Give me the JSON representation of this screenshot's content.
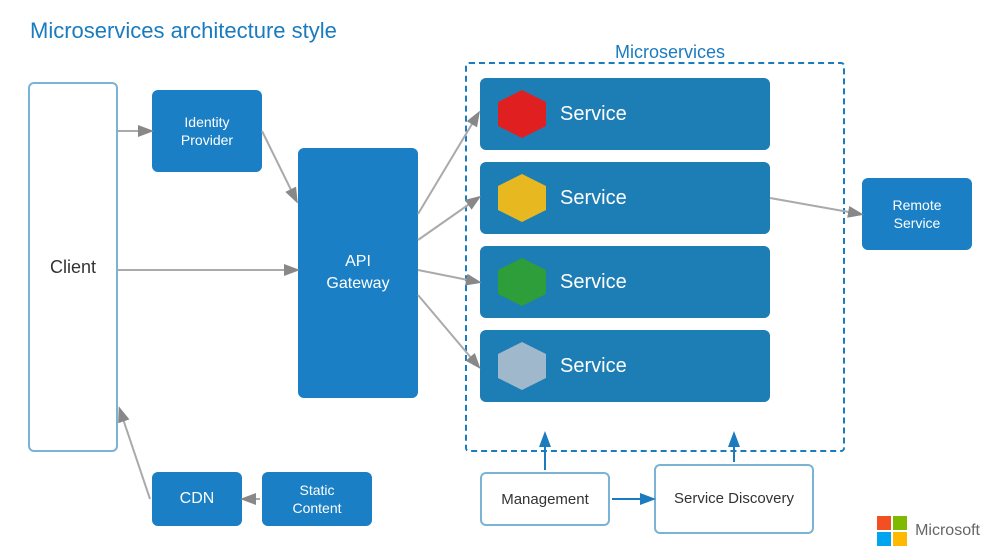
{
  "title": "Microservices architecture style",
  "microservices_label": "Microservices",
  "client_label": "Client",
  "identity_provider_label": "Identity\nProvider",
  "api_gateway_label": "API\nGateway",
  "services": [
    {
      "label": "Service",
      "hex_color": "red"
    },
    {
      "label": "Service",
      "hex_color": "yellow"
    },
    {
      "label": "Service",
      "hex_color": "green"
    },
    {
      "label": "Service",
      "hex_color": "blue"
    }
  ],
  "remote_service_label": "Remote\nService",
  "cdn_label": "CDN",
  "static_content_label": "Static\nContent",
  "management_label": "Management",
  "service_discovery_label": "Service Discovery",
  "microsoft_label": "Microsoft",
  "colors": {
    "blue": "#1a7fc4",
    "dark_blue": "#1d7db5",
    "title_blue": "#1a7bbf",
    "border_blue": "#7ab3d4"
  }
}
